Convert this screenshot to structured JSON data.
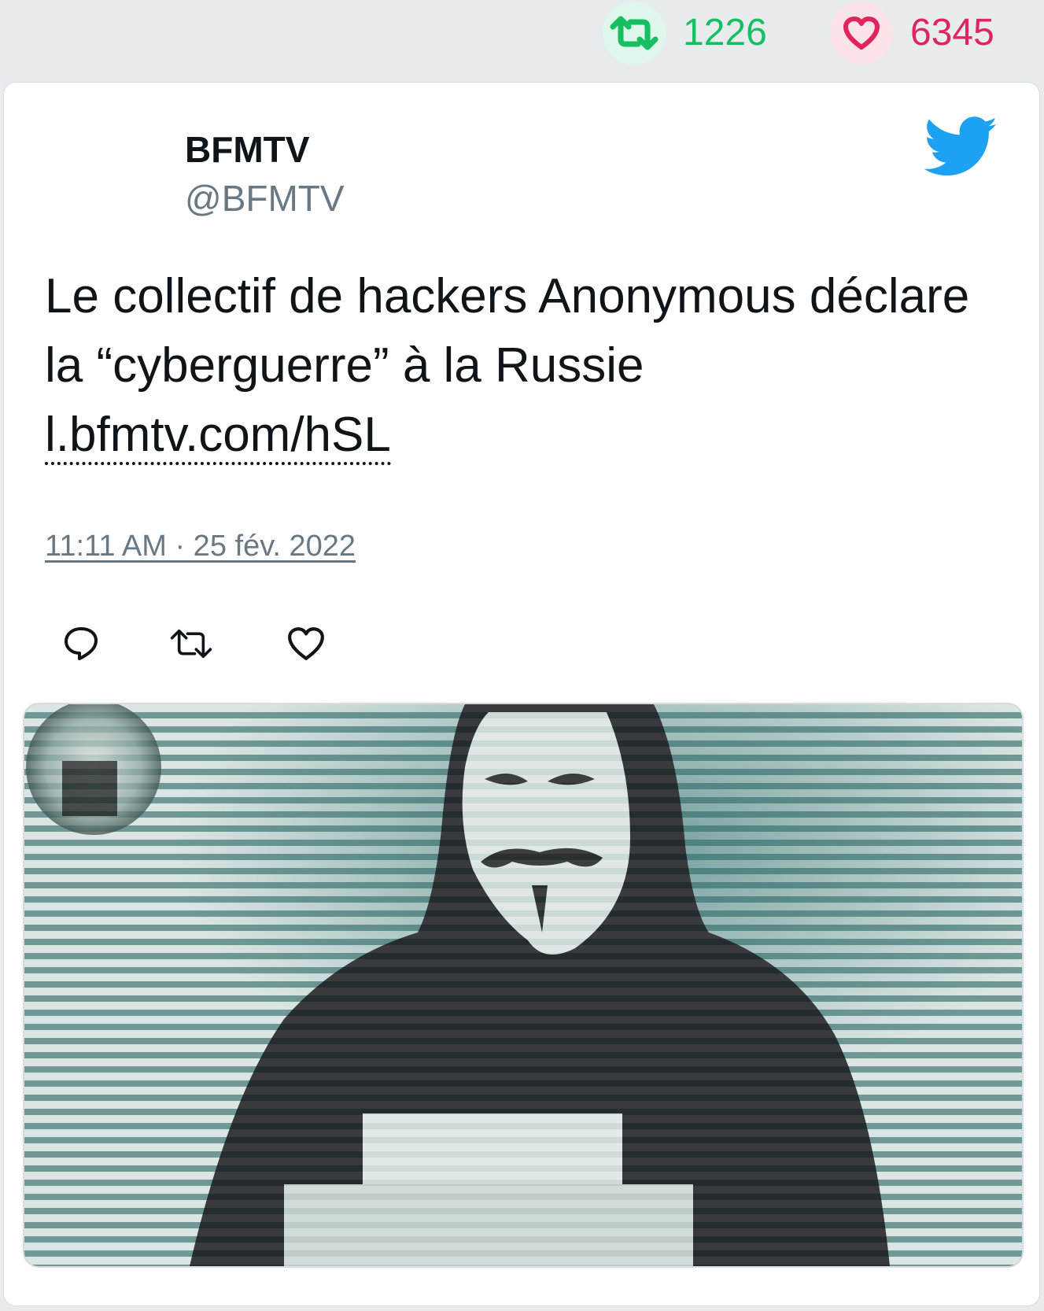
{
  "stats": {
    "retweet_count": "1226",
    "like_count": "6345",
    "retweet_icon": "retweet-icon",
    "like_icon": "heart-icon",
    "retweet_color": "#17bf63",
    "like_color": "#e0245e"
  },
  "tweet": {
    "author_name": "BFMTV",
    "author_handle": "@BFMTV",
    "text": "Le collectif de hackers Anonymous déclare la “cyberguerre” à la Russie",
    "link": "l.bfmtv.com/hSL",
    "timestamp": "11:11 AM · 25 fév. 2022",
    "brand_icon": "twitter-bird-icon",
    "brand_color": "#1da1f2"
  },
  "actions": [
    {
      "name": "reply",
      "icon": "reply-icon"
    },
    {
      "name": "retweet",
      "icon": "retweet-icon"
    },
    {
      "name": "like",
      "icon": "heart-icon"
    }
  ],
  "media": {
    "type": "image",
    "subject": "person-in-guy-fawkes-mask-icon"
  }
}
